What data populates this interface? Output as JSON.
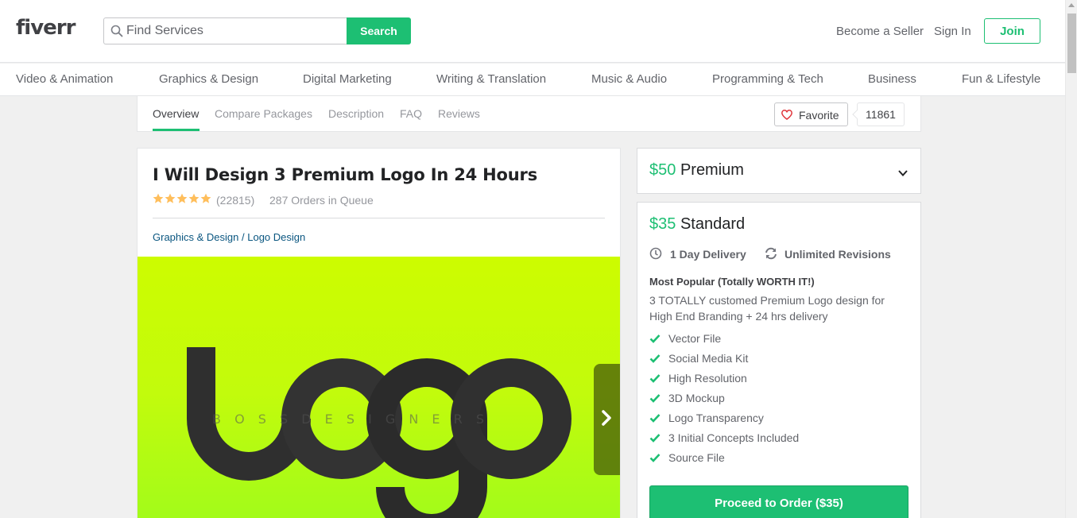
{
  "header": {
    "logo": "fiverr",
    "search_placeholder": "Find Services",
    "search_button": "Search",
    "become_seller": "Become a Seller",
    "sign_in": "Sign In",
    "join": "Join"
  },
  "categories": [
    "Video & Animation",
    "Graphics & Design",
    "Digital Marketing",
    "Writing & Translation",
    "Music & Audio",
    "Programming & Tech",
    "Business",
    "Fun & Lifestyle"
  ],
  "subnav": {
    "tabs": [
      "Overview",
      "Compare Packages",
      "Description",
      "FAQ",
      "Reviews"
    ],
    "active_tab": "Overview",
    "favorite_label": "Favorite",
    "favorite_count": "11861"
  },
  "gig": {
    "title": "I Will Design 3 Premium Logo In 24 Hours",
    "rating_stars": 5,
    "rating_count": "(22815)",
    "orders_in_queue": "287 Orders in Queue",
    "breadcrumb_category": "Graphics & Design",
    "breadcrumb_separator": " / ",
    "breadcrumb_subcategory": "Logo Design",
    "image_word": "Logo",
    "image_tagline": "B O S S   D E S I G N E R S"
  },
  "packages": {
    "premium": {
      "price": "$50",
      "name": "Premium"
    },
    "standard": {
      "price": "$35",
      "name": "Standard",
      "delivery": "1 Day Delivery",
      "revisions": "Unlimited Revisions",
      "desc_title": "Most Popular (Totally WORTH IT!)",
      "description": "3 TOTALLY customed Premium Logo design for High End Branding + 24 hrs delivery",
      "features": [
        "Vector File",
        "Social Media Kit",
        "High Resolution",
        "3D Mockup",
        "Logo Transparency",
        "3 Initial Concepts Included",
        "Source File"
      ],
      "order_button": "Proceed to Order ($35)"
    }
  },
  "colors": {
    "brand_green": "#1dbf73",
    "star_yellow": "#ffbe5b",
    "link_blue": "#0a5680",
    "favorite_red": "#e0353b"
  }
}
